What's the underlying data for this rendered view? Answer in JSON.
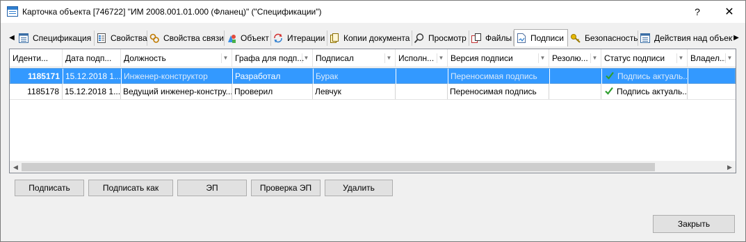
{
  "window": {
    "title": "Карточка объекта [746722] \"ИМ 2008.001.01.000 (Фланец)\" (\"Спецификации\")",
    "help_label": "?",
    "close_label": "✕"
  },
  "tabs": [
    {
      "label": "Спецификация",
      "icon": "list-icon"
    },
    {
      "label": "Свойства",
      "icon": "properties-icon"
    },
    {
      "label": "Свойства связи",
      "icon": "link-properties-icon"
    },
    {
      "label": "Объект",
      "icon": "object-icon"
    },
    {
      "label": "Итерации",
      "icon": "iterations-icon"
    },
    {
      "label": "Копии документа",
      "icon": "document-copies-icon"
    },
    {
      "label": "Просмотр",
      "icon": "magnifier-icon"
    },
    {
      "label": "Файлы",
      "icon": "files-icon"
    },
    {
      "label": "Подписи",
      "icon": "signature-icon",
      "active": true
    },
    {
      "label": "Безопасность",
      "icon": "key-icon"
    },
    {
      "label": "Действия над объект",
      "icon": "actions-icon"
    }
  ],
  "grid": {
    "columns": [
      "Иденти...",
      "Дата подп...",
      "Должность",
      "Графа для подп...",
      "Подписал",
      "Исполн...",
      "Версия подписи",
      "Резолю...",
      "Статус подписи",
      "Владел..."
    ],
    "rows": [
      {
        "id": "1185171",
        "date": "15.12.2018  1...",
        "position": "Инженер-конструктор",
        "field": "Разработал",
        "signer": "Бурак",
        "executor": "",
        "version": "Переносимая подпись",
        "resolution": "",
        "status": "Подпись актуаль...",
        "owner": "",
        "selected": true
      },
      {
        "id": "1185178",
        "date": "15.12.2018  1...",
        "position": "Ведущий инженер-констру...",
        "field": "Проверил",
        "signer": "Левчук",
        "executor": "",
        "version": "Переносимая подпись",
        "resolution": "",
        "status": "Подпись актуаль...",
        "owner": "",
        "selected": false
      }
    ]
  },
  "buttons": {
    "sign": "Подписать",
    "sign_as": "Подписать как",
    "ep": "ЭП",
    "check_ep": "Проверка ЭП",
    "delete": "Удалить",
    "close": "Закрыть"
  },
  "colors": {
    "selection": "#3399ff",
    "check": "#2e9e2e"
  }
}
